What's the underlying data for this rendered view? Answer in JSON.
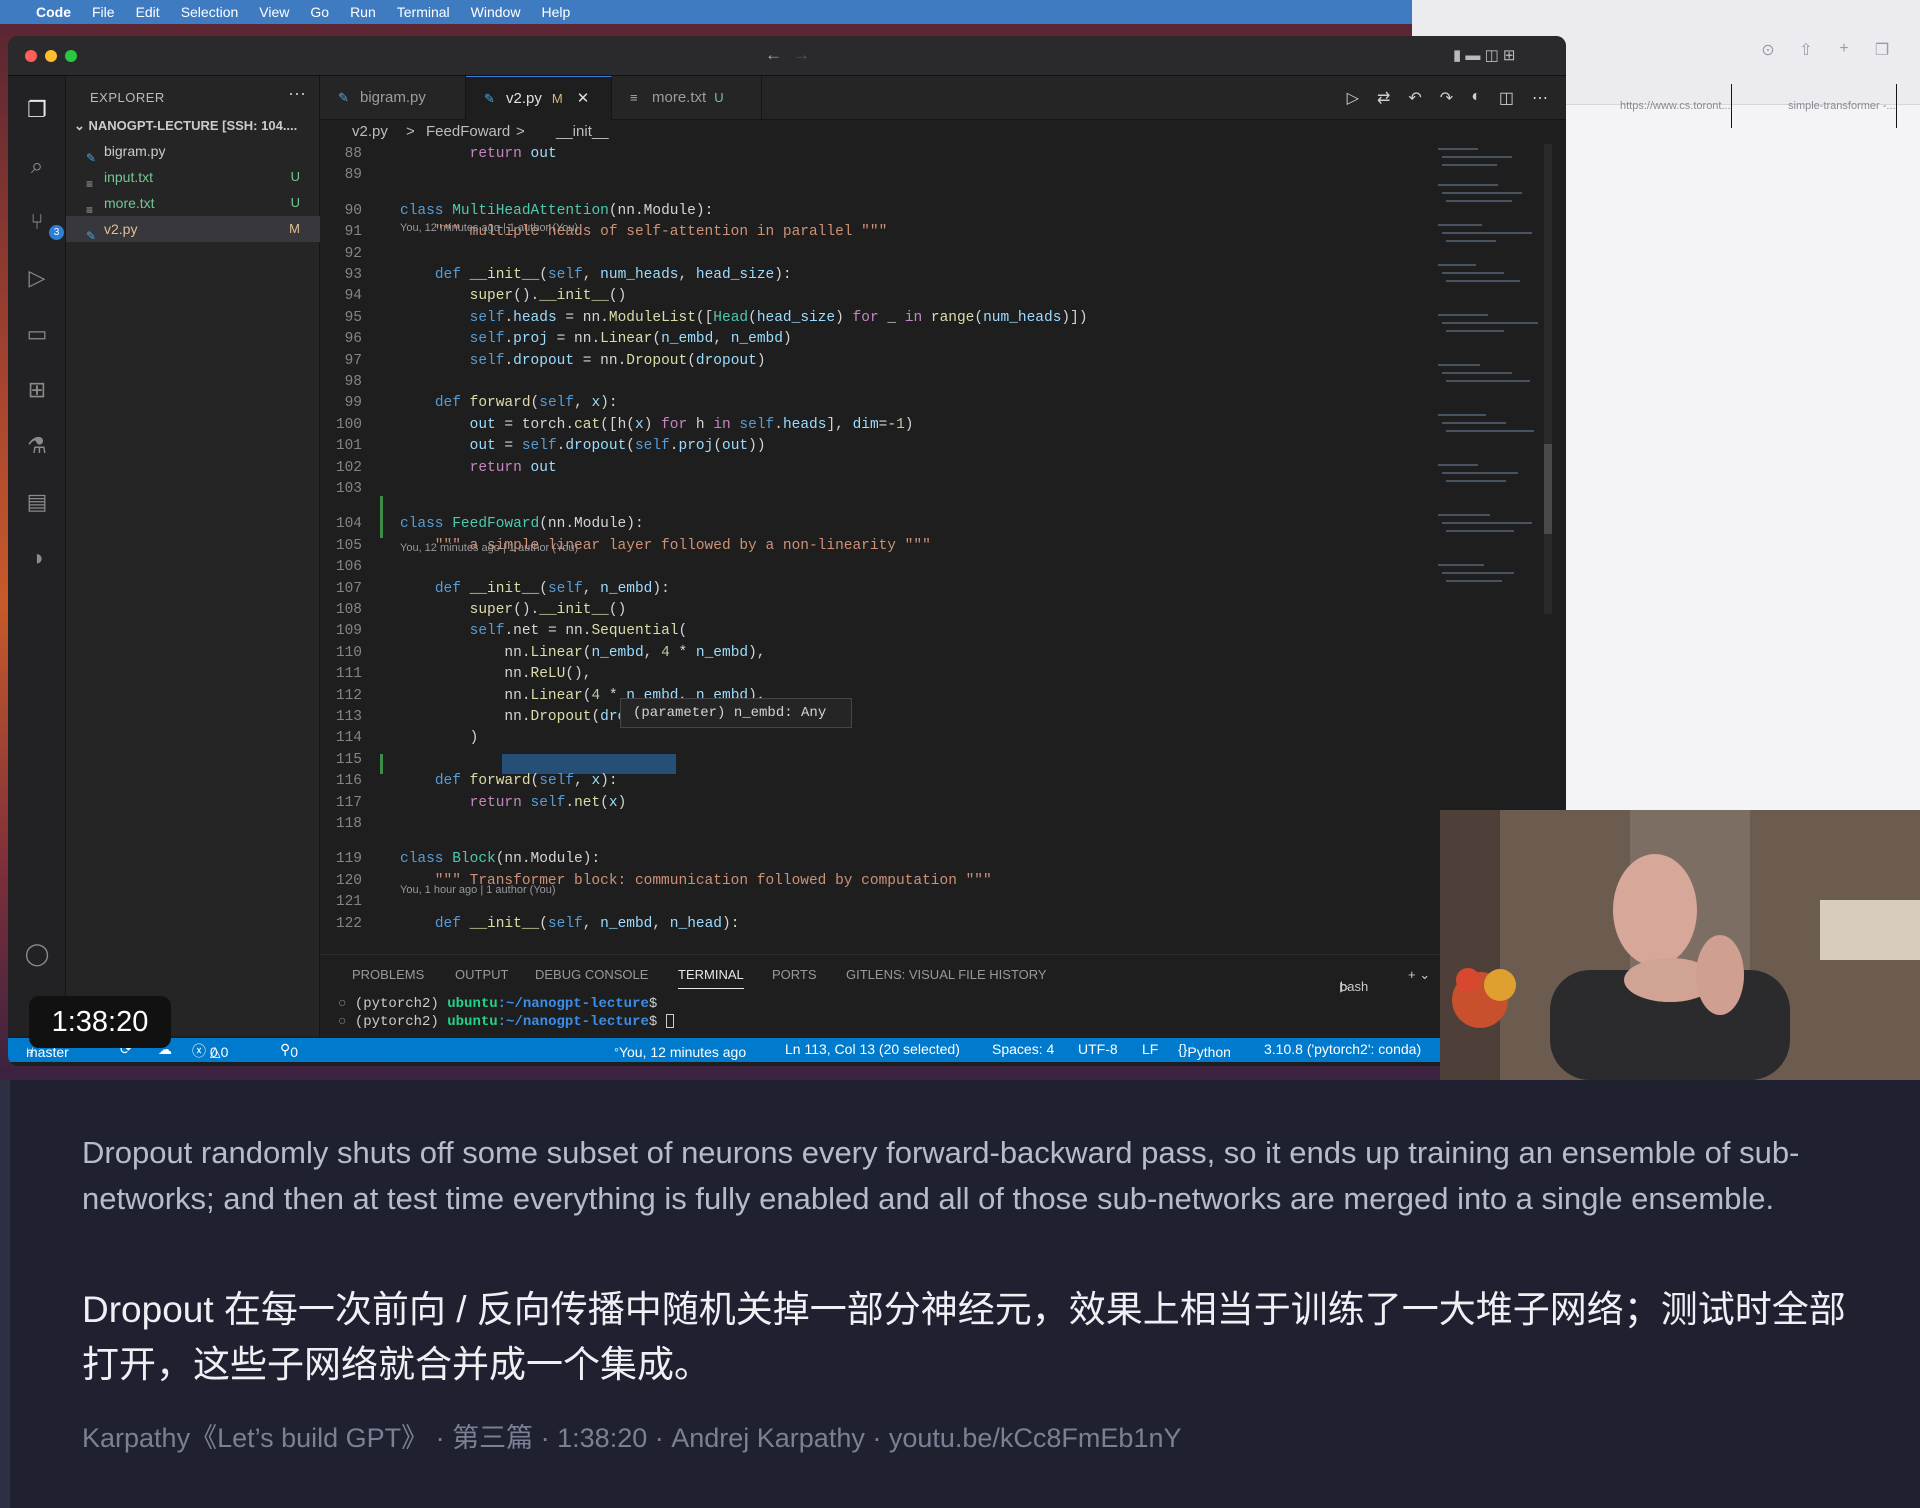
{
  "menubar": {
    "app": "Code",
    "items": [
      "File",
      "Edit",
      "Selection",
      "View",
      "Go",
      "Run",
      "Terminal",
      "Window",
      "Help"
    ]
  },
  "browser": {
    "tab1": "https://www.cs.toront...",
    "tab2": "simple-transformer -..."
  },
  "explorer": {
    "title": "EXPLORER",
    "project": "NANOGPT-LECTURE [SSH: 104....",
    "files": [
      {
        "name": "bigram.py",
        "status": ""
      },
      {
        "name": "input.txt",
        "status": "U"
      },
      {
        "name": "more.txt",
        "status": "U"
      },
      {
        "name": "v2.py",
        "status": "M"
      }
    ]
  },
  "activity": {
    "scm_badge": "3"
  },
  "tabs": [
    {
      "label": "bigram.py",
      "status": ""
    },
    {
      "label": "v2.py",
      "status": "M",
      "close": "✕"
    },
    {
      "label": "more.txt",
      "status": "U"
    }
  ],
  "breadcrumb": {
    "file": "v2.py",
    "sep1": ">",
    "class": "FeedFoward",
    "sep2": ">",
    "method": "__init__"
  },
  "editor": {
    "lens1": "You, 12 minutes ago | 1 author (You)",
    "lens2": "You, 12 minutes ago | 1 author (You)",
    "lens3": "You, 1 hour ago | 1 author (You)",
    "hover": "(parameter) n_embd: Any",
    "lines": [
      {
        "n": "88",
        "t": "        return out"
      },
      {
        "n": "89",
        "t": ""
      },
      {
        "n": "90",
        "t": "class MultiHeadAttention(nn.Module):"
      },
      {
        "n": "91",
        "t": "    \"\"\" multiple heads of self-attention in parallel \"\"\""
      },
      {
        "n": "92",
        "t": ""
      },
      {
        "n": "93",
        "t": "    def __init__(self, num_heads, head_size):"
      },
      {
        "n": "94",
        "t": "        super().__init__()"
      },
      {
        "n": "95",
        "t": "        self.heads = nn.ModuleList([Head(head_size) for _ in range(num_heads)])"
      },
      {
        "n": "96",
        "t": "        self.proj = nn.Linear(n_embd, n_embd)"
      },
      {
        "n": "97",
        "t": "        self.dropout = nn.Dropout(dropout)"
      },
      {
        "n": "98",
        "t": ""
      },
      {
        "n": "99",
        "t": "    def forward(self, x):"
      },
      {
        "n": "100",
        "t": "        out = torch.cat([h(x) for h in self.heads], dim=-1)"
      },
      {
        "n": "101",
        "t": "        out = self.dropout(self.proj(out))"
      },
      {
        "n": "102",
        "t": "        return out"
      },
      {
        "n": "103",
        "t": ""
      },
      {
        "n": "104",
        "t": "class FeedFoward(nn.Module):"
      },
      {
        "n": "105",
        "t": "    \"\"\" a simple linear layer followed by a non-linearity \"\"\""
      },
      {
        "n": "106",
        "t": ""
      },
      {
        "n": "107",
        "t": "    def __init__(self, n_embd):"
      },
      {
        "n": "108",
        "t": "        super().__init__()"
      },
      {
        "n": "109",
        "t": "        self.net = nn.Sequential("
      },
      {
        "n": "110",
        "t": "            nn.Linear(n_embd, 4 * n_embd),"
      },
      {
        "n": "111",
        "t": "            nn.ReLU(),"
      },
      {
        "n": "112",
        "t": "            nn.Linear(4 * n_embd, n_embd),"
      },
      {
        "n": "113",
        "t": "            nn.Dropout(dropout),"
      },
      {
        "n": "114",
        "t": "        )"
      },
      {
        "n": "115",
        "t": ""
      },
      {
        "n": "116",
        "t": "    def forward(self, x):"
      },
      {
        "n": "117",
        "t": "        return self.net(x)"
      },
      {
        "n": "118",
        "t": ""
      },
      {
        "n": "119",
        "t": "class Block(nn.Module):"
      },
      {
        "n": "120",
        "t": "    \"\"\" Transformer block: communication followed by computation \"\"\""
      },
      {
        "n": "121",
        "t": ""
      },
      {
        "n": "122",
        "t": "    def __init__(self, n_embd, n_head):"
      }
    ]
  },
  "panel": {
    "tabs": [
      "PROBLEMS",
      "OUTPUT",
      "DEBUG CONSOLE",
      "TERMINAL",
      "PORTS",
      "GITLENS: VISUAL FILE HISTORY"
    ],
    "shell": "bash"
  },
  "terminal": {
    "env": "(pytorch2)",
    "host": "ubuntu",
    "path": ":~/nanogpt-lecture",
    "prompt": "$"
  },
  "status": {
    "branch": "master",
    "errors": "0",
    "warnings": "0",
    "ports": "0",
    "blame": "You, 12 minutes ago",
    "cursor": "Ln 113, Col 13 (20 selected)",
    "spaces": "Spaces: 4",
    "encoding": "UTF-8",
    "eol": "LF",
    "lang": "Python",
    "interpreter": "3.10.8 ('pytorch2': conda)"
  },
  "timer": "1:38:20",
  "subtitle": {
    "en": "Dropout randomly shuts off some subset of neurons every forward-backward pass, so it ends up training an ensemble of sub-networks; and then at test time everything is fully enabled and all of those sub-networks are merged into a single ensemble.",
    "zh": "Dropout 在每一次前向 / 反向传播中随机关掉一部分神经元，效果上相当于训练了一大堆子网络；测试时全部打开，这些子网络就合并成一个集成。",
    "source": "Karpathy《Let’s build GPT》 · 第三篇 · 1:38:20 · Andrej Karpathy · youtu.be/kCc8FmEb1nY"
  }
}
